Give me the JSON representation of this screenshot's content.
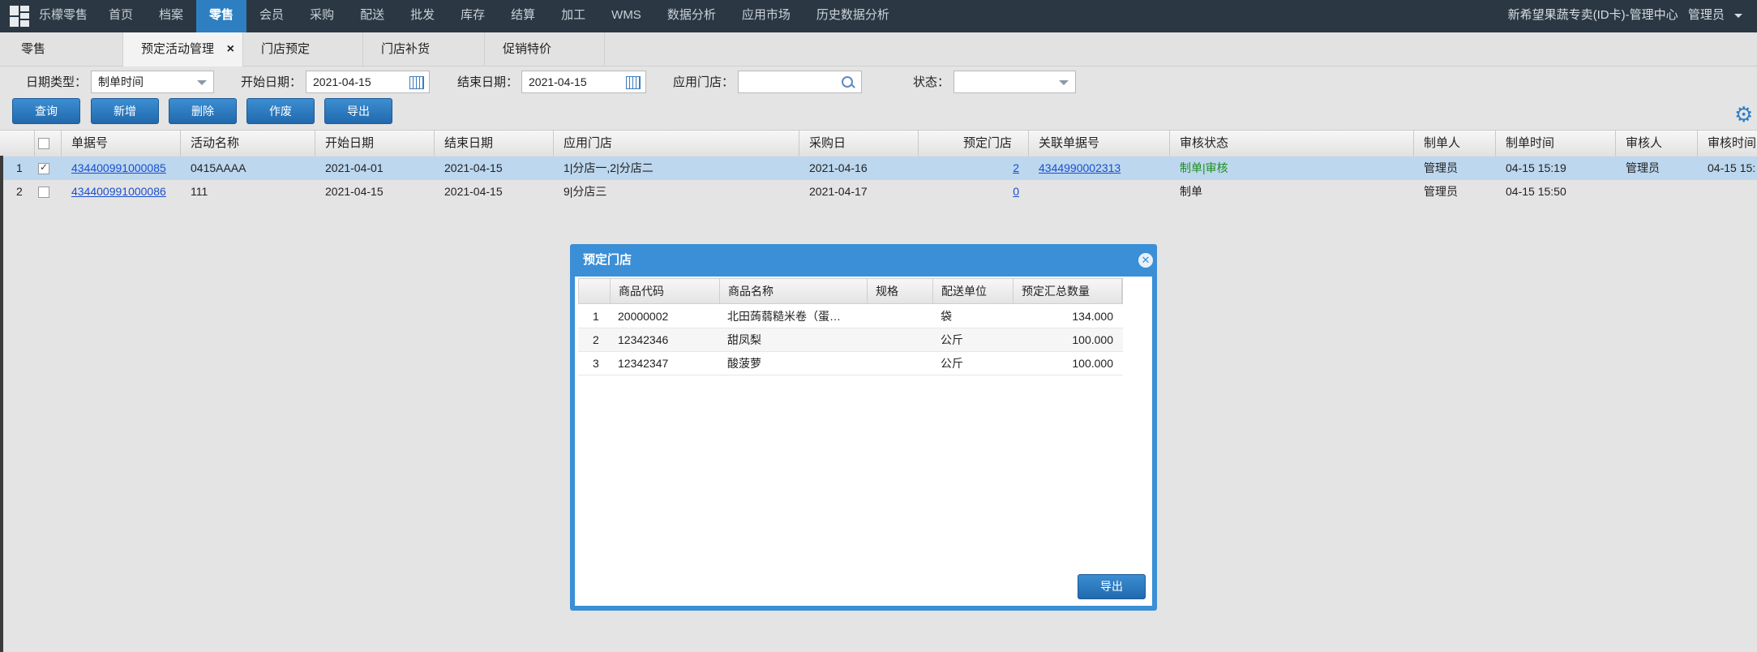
{
  "topnav": {
    "brand": "乐檬零售",
    "items": [
      "首页",
      "档案",
      "零售",
      "会员",
      "采购",
      "配送",
      "批发",
      "库存",
      "结算",
      "加工",
      "WMS",
      "数据分析",
      "应用市场",
      "历史数据分析"
    ],
    "active_index": 2,
    "account": "新希望果蔬专卖(ID卡)-管理中心",
    "user": "管理员"
  },
  "tabs": [
    {
      "label": "零售",
      "active": false
    },
    {
      "label": "预定活动管理",
      "active": true,
      "close": "×"
    },
    {
      "label": "门店预定",
      "active": false
    },
    {
      "label": "门店补货",
      "active": false
    },
    {
      "label": "促销特价",
      "active": false
    }
  ],
  "filters": {
    "date_type_label": "日期类型：",
    "date_type_value": "制单时间",
    "start_label": "开始日期：",
    "start_value": "2021-04-15",
    "end_label": "结束日期：",
    "end_value": "2021-04-15",
    "store_label": "应用门店：",
    "store_value": "",
    "status_label": "状态：",
    "status_value": ""
  },
  "buttons": [
    "查询",
    "新增",
    "删除",
    "作废",
    "导出"
  ],
  "grid": {
    "headers": [
      "单据号",
      "活动名称",
      "开始日期",
      "结束日期",
      "应用门店",
      "采购日",
      "预定门店",
      "关联单据号",
      "审核状态",
      "制单人",
      "制单时间",
      "审核人",
      "审核时间"
    ],
    "rows": [
      {
        "num": "1",
        "checked": true,
        "doc": "434400991000085",
        "name": "0415AAAA",
        "start": "2021-04-01",
        "end": "2021-04-15",
        "stores": "1|分店一,2|分店二",
        "purchase": "2021-04-16",
        "booked": "2",
        "related": "4344990002313",
        "status": "制单|审核",
        "creator": "管理员",
        "created": "04-15 15:19",
        "auditor": "管理员",
        "audited": "04-15 15:"
      },
      {
        "num": "2",
        "checked": false,
        "doc": "434400991000086",
        "name": "111",
        "start": "2021-04-15",
        "end": "2021-04-15",
        "stores": "9|分店三",
        "purchase": "2021-04-17",
        "booked": "0",
        "related": "",
        "status": "制单",
        "creator": "管理员",
        "created": "04-15 15:50",
        "auditor": "",
        "audited": ""
      }
    ]
  },
  "dialog": {
    "title": "预定门店",
    "close": "✕",
    "headers": [
      "商品代码",
      "商品名称",
      "规格",
      "配送单位",
      "预定汇总数量"
    ],
    "rows": [
      {
        "num": "1",
        "code": "20000002",
        "name": "北田蒟蒻糙米卷（蛋…",
        "spec": "",
        "unit": "袋",
        "qty": "134.000"
      },
      {
        "num": "2",
        "code": "12342346",
        "name": "甜凤梨",
        "spec": "",
        "unit": "公斤",
        "qty": "100.000"
      },
      {
        "num": "3",
        "code": "12342347",
        "name": "酸菠萝",
        "spec": "",
        "unit": "公斤",
        "qty": "100.000"
      }
    ],
    "export_label": "导出"
  },
  "colors": {
    "nav_bg": "#2b3742",
    "accent": "#2d7fc2",
    "dialog_border": "#3a8fd6",
    "link": "#1a4ecf",
    "status_green": "#1d8f1d"
  },
  "icons": {
    "logo": "grid-logo-icon",
    "settings": "gear-icon",
    "calendar": "calendar-icon",
    "search": "search-icon",
    "close": "close-icon"
  }
}
